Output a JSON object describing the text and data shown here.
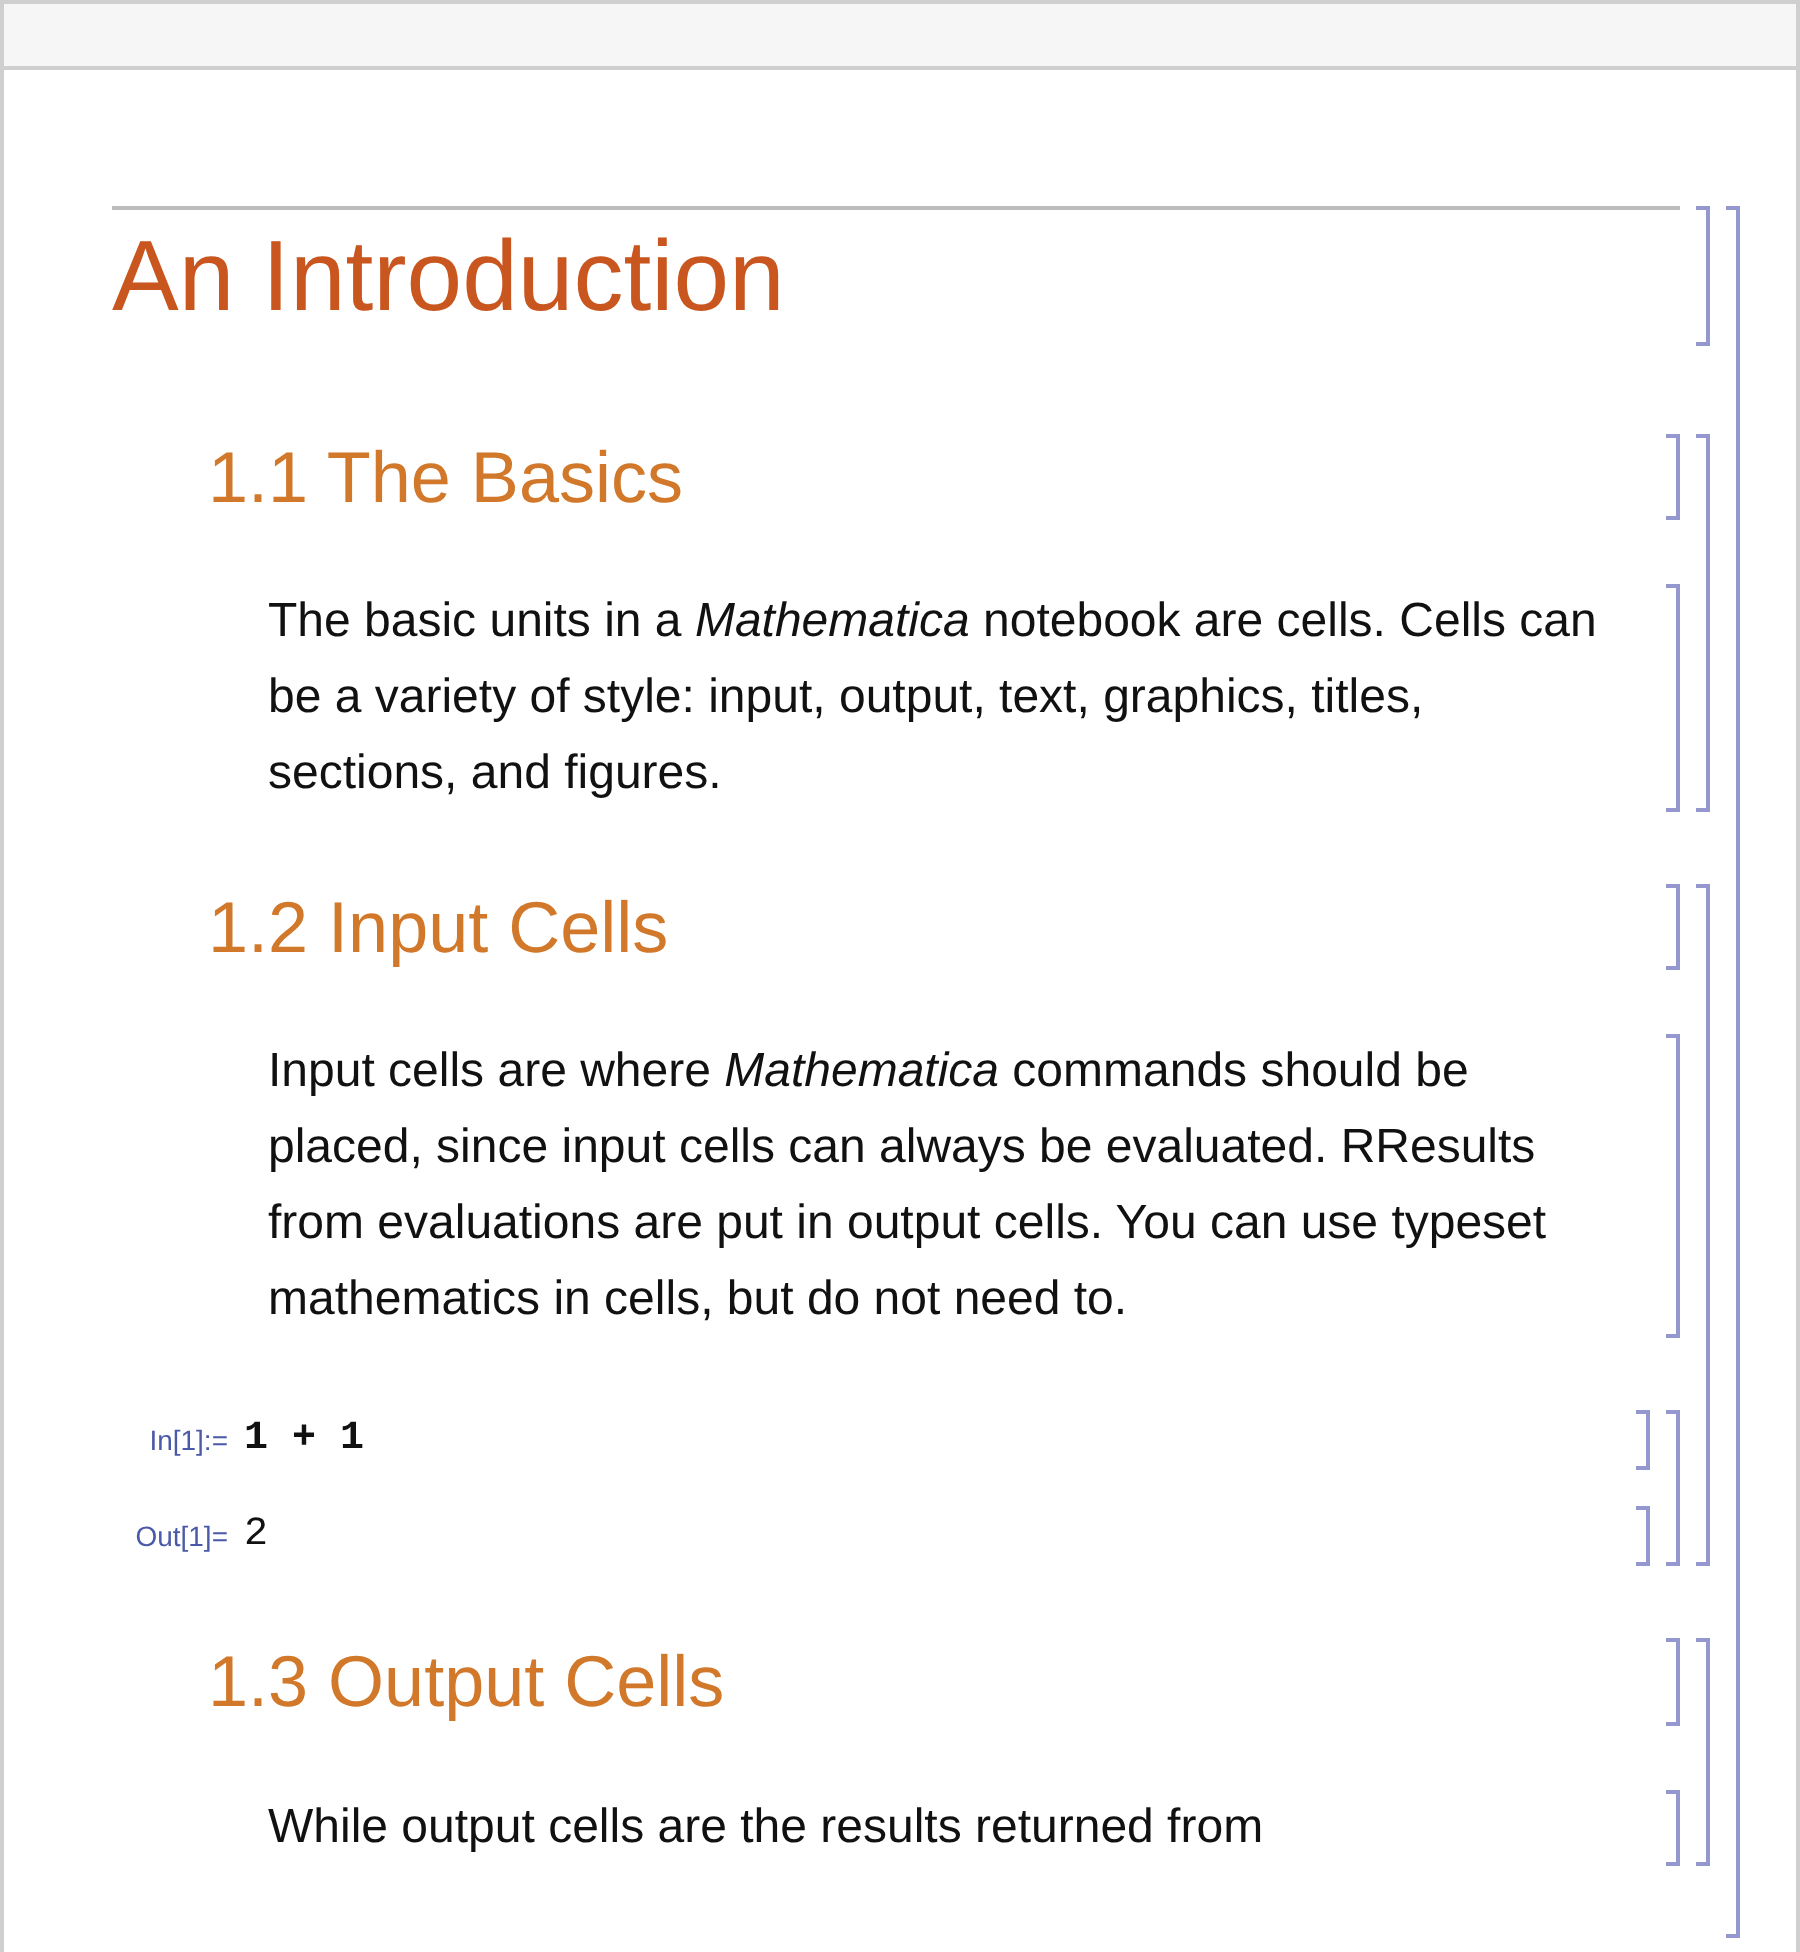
{
  "notebook": {
    "title": "An Introduction",
    "sections": [
      {
        "heading": "1.1 The Basics",
        "cells": [
          {
            "kind": "text",
            "text": "The basic units in a *Mathematica* notebook are cells. Cells can be a variety of style: input, output, text, graphics, titles, sections, and figures."
          }
        ]
      },
      {
        "heading": "1.2 Input Cells",
        "cells": [
          {
            "kind": "text",
            "text": "Input cells are where *Mathematica* commands should be placed, since input cells can always be evaluated. RResults from evaluations are put in output cells. You can use typeset mathematics in cells, but do not need to."
          },
          {
            "kind": "io",
            "input": {
              "label": "In[1]:=",
              "code": "1 + 1"
            },
            "output": {
              "label": "Out[1]=",
              "value": "2"
            }
          }
        ]
      },
      {
        "heading": "1.3 Output Cells",
        "cells": [
          {
            "kind": "text",
            "text": "While output cells are the results returned from"
          }
        ]
      }
    ]
  }
}
